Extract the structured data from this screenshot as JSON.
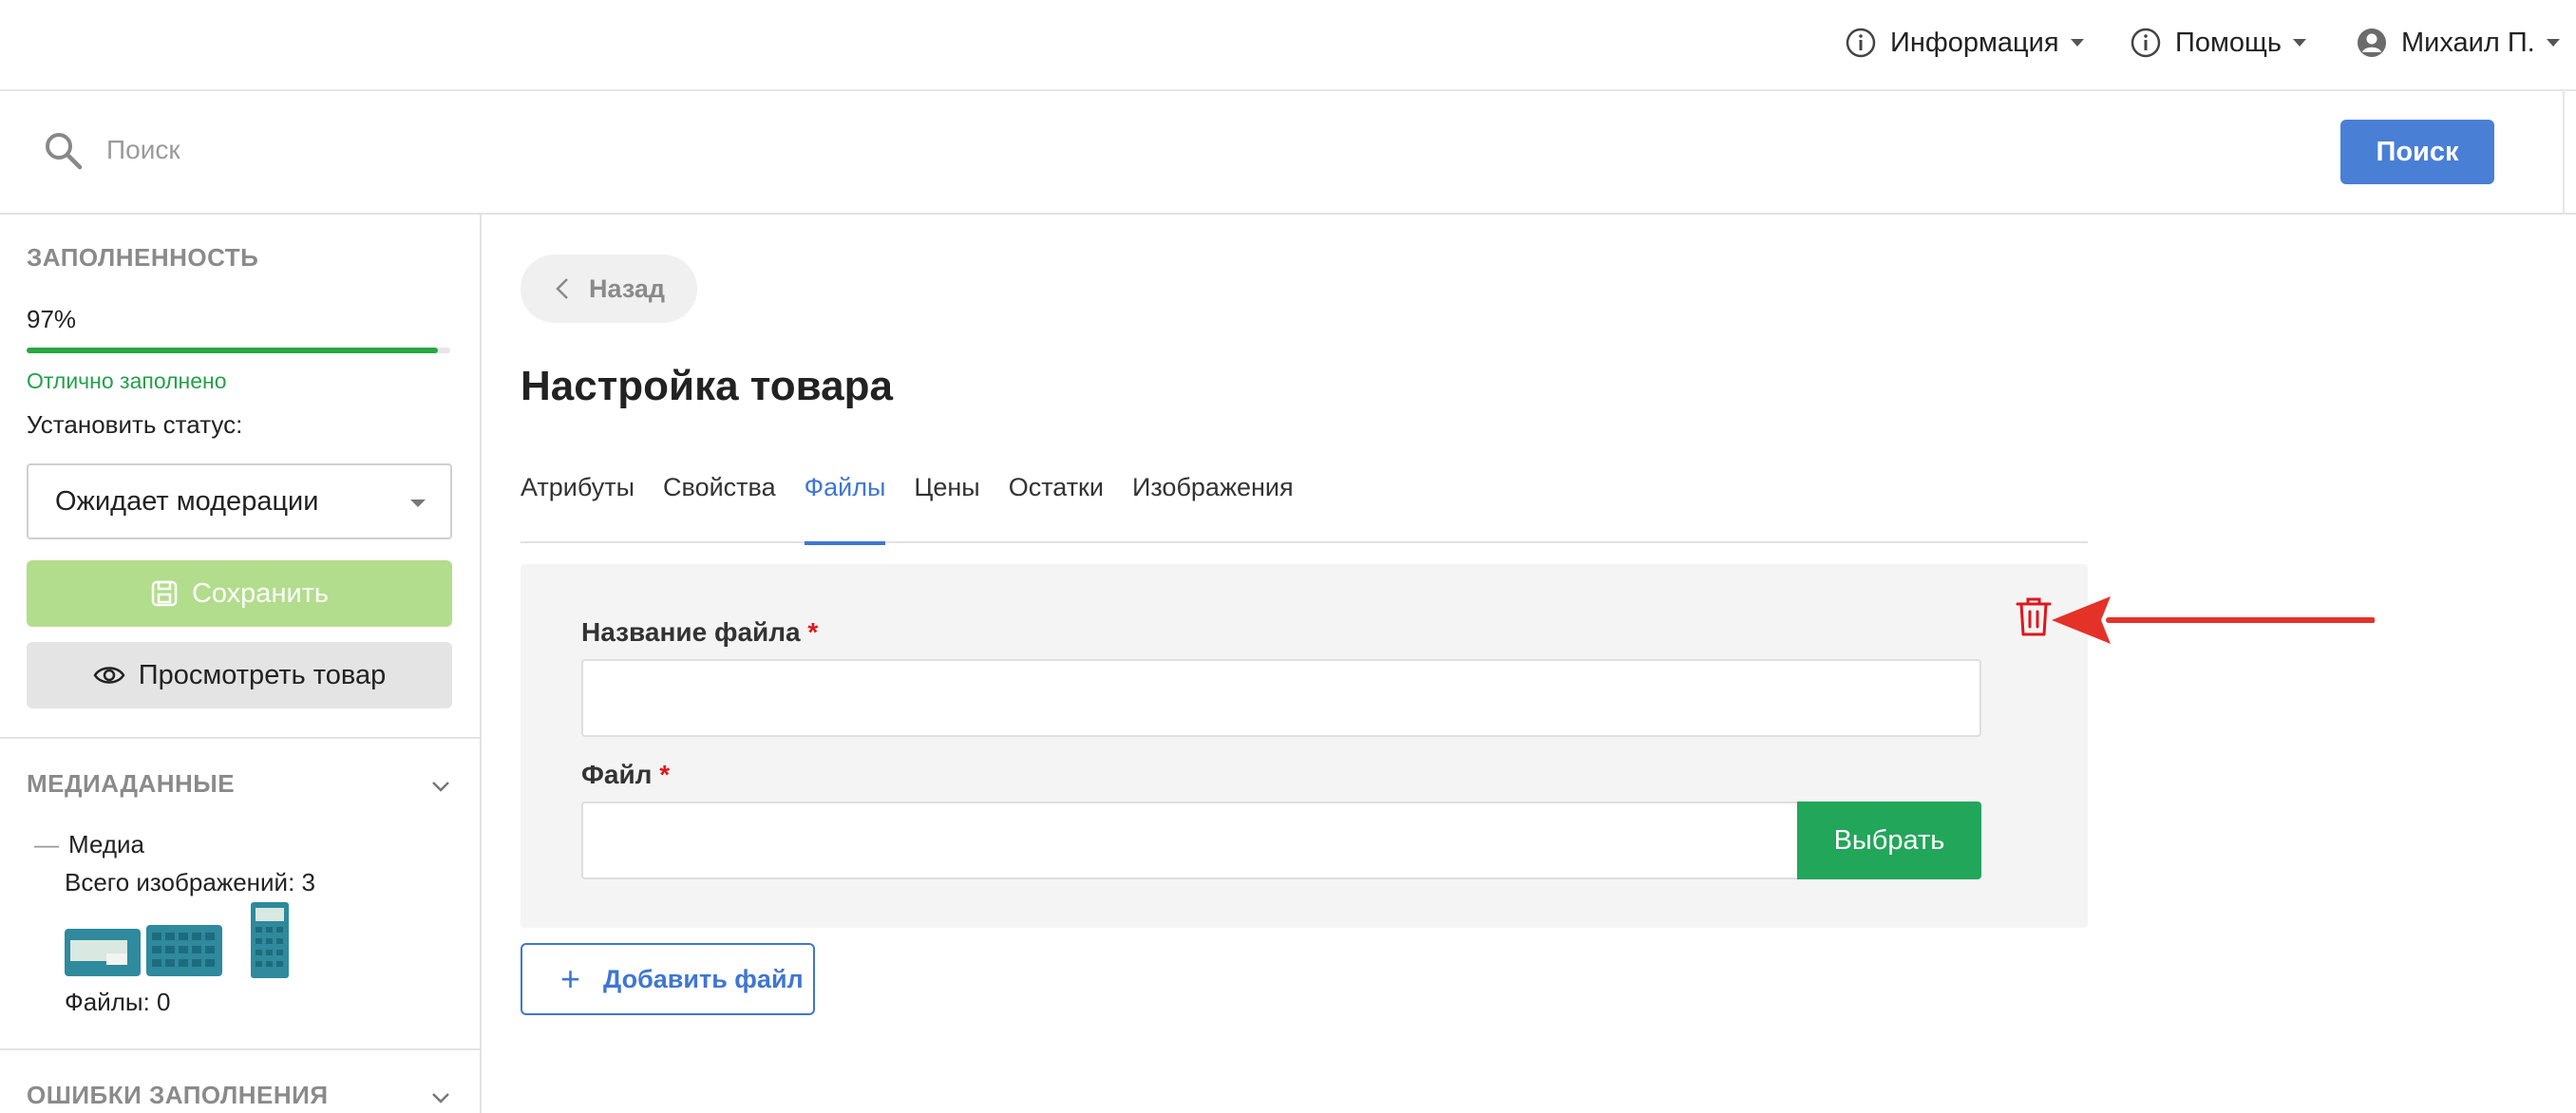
{
  "topnav": {
    "info_label": "Информация",
    "help_label": "Помощь",
    "user_label": "Михаил П."
  },
  "search": {
    "placeholder": "Поиск",
    "button_label": "Поиск"
  },
  "sidebar": {
    "completeness_heading": "ЗАПОЛНЕННОСТЬ",
    "percent_text": "97%",
    "percent_value": 97,
    "fill_status": "Отлично заполнено",
    "set_status_label": "Установить статус:",
    "status_value": "Ожидает модерации",
    "save_label": "Сохранить",
    "view_label": "Просмотреть товар",
    "media_heading": "МЕДИАДАННЫЕ",
    "media_label": "Медиа",
    "images_total": "Всего изображений: 3",
    "files_count": "Файлы: 0",
    "errors_heading": "ОШИБКИ ЗАПОЛНЕНИЯ"
  },
  "main": {
    "back_label": "Назад",
    "title": "Настройка товара",
    "tabs": [
      {
        "label": "Атрибуты",
        "active": false
      },
      {
        "label": "Свойства",
        "active": false
      },
      {
        "label": "Файлы",
        "active": true
      },
      {
        "label": "Цены",
        "active": false
      },
      {
        "label": "Остатки",
        "active": false
      },
      {
        "label": "Изображения",
        "active": false
      }
    ],
    "file_card": {
      "name_label": "Название файла",
      "name_value": "",
      "file_label": "Файл",
      "file_value": "",
      "required_mark": "*",
      "choose_label": "Выбрать"
    },
    "add_file_label": "Добавить файл"
  },
  "colors": {
    "accent": "#3f76d2",
    "search_button": "#4a7fd6",
    "success": "#22a65a",
    "danger": "#e0161b",
    "progress": "#27a844",
    "save_disabled": "#b2dd8c"
  }
}
